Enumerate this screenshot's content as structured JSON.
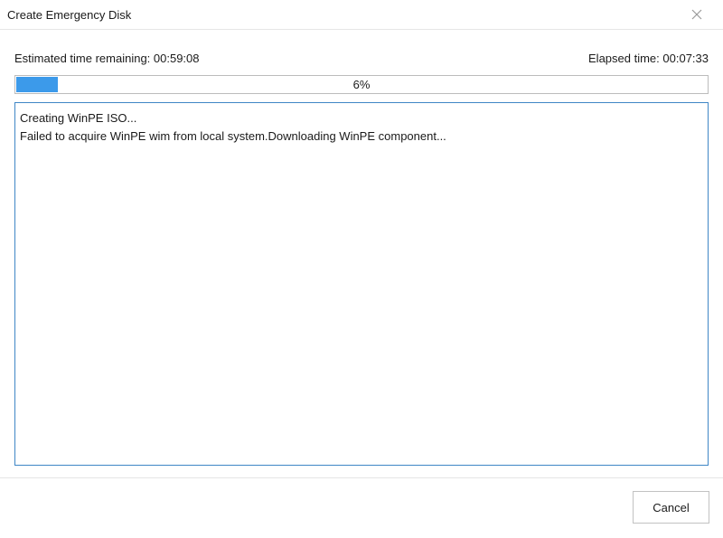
{
  "window": {
    "title": "Create Emergency Disk",
    "close_icon": "close-icon"
  },
  "status": {
    "estimated_remaining": "Estimated time remaining: 00:59:08",
    "elapsed": "Elapsed time: 00:07:33"
  },
  "progress": {
    "percent": 6,
    "label": "6%",
    "fill_color": "#3c9aea"
  },
  "log": {
    "lines": [
      "Creating WinPE ISO...",
      "Failed to acquire WinPE wim from local system.Downloading WinPE component..."
    ]
  },
  "footer": {
    "cancel_label": "Cancel"
  }
}
